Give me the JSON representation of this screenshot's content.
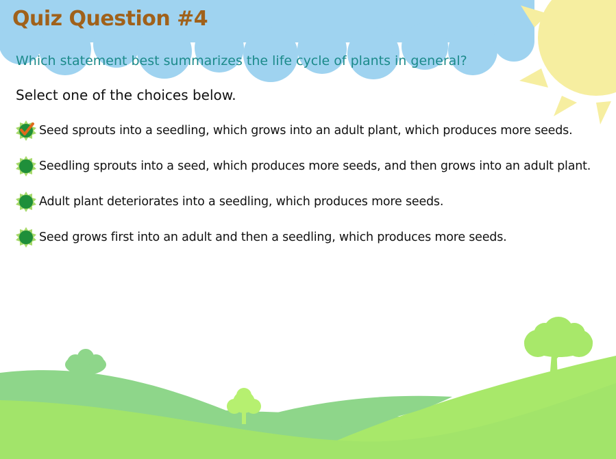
{
  "quiz": {
    "title": "Quiz Question #4",
    "question": "Which statement best summarizes the life cycle of plants in general?",
    "instruction": "Select one of the choices below.",
    "selected_index": 0,
    "choices": [
      {
        "label": "Seed sprouts into a seedling, which grows into an adult plant, which produces more seeds.",
        "checked": true
      },
      {
        "label": "Seedling sprouts into a seed, which produces more seeds, and then grows into an adult plant.",
        "checked": false
      },
      {
        "label": "Adult plant deteriorates into a seedling, which produces more seeds.",
        "checked": false
      },
      {
        "label": "Seed grows first into an adult and then a seedling, which produces more seeds.",
        "checked": false
      }
    ]
  },
  "colors": {
    "title": "#a0611a",
    "question": "#1b8a8a",
    "sky": "#9fd3f0",
    "sun": "#f6eea0",
    "hill_light": "#a8e86a",
    "hill_dark": "#7fcf80",
    "radio_fill": "#1f8f3a",
    "radio_ring": "#a6d96a",
    "check": "#e06a1c"
  },
  "icons": {
    "radio": "sunburst-radio-icon",
    "checked": "checkmark-icon"
  }
}
